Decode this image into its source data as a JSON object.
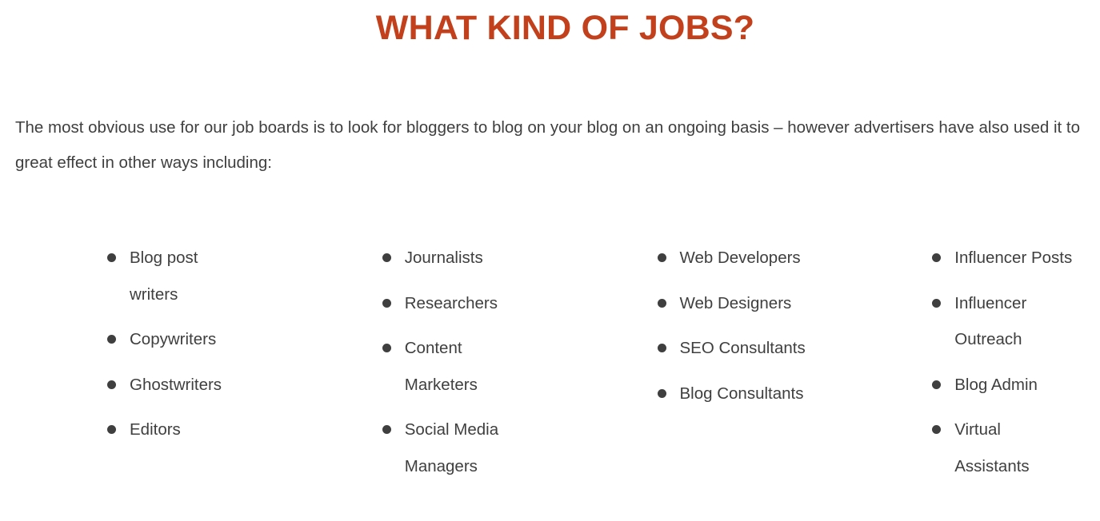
{
  "page": {
    "background_color": "#ffffff",
    "text_color": "#3f3f3f",
    "accent_color": "#c2401b",
    "bullet_color": "#3f3f3f"
  },
  "heading": {
    "text": "WHAT KIND OF JOBS?"
  },
  "intro": {
    "paragraph": "The most obvious use for our job boards is to look for bloggers to blog on your blog on an ongoing basis – however advertisers have also used it to great effect in other ways including:"
  },
  "columns": [
    {
      "id": "column-1",
      "items": [
        {
          "label": "Blog post writers"
        },
        {
          "label": "Copywriters"
        },
        {
          "label": "Ghostwriters"
        },
        {
          "label": "Editors"
        }
      ]
    },
    {
      "id": "column-2",
      "items": [
        {
          "label": "Journalists"
        },
        {
          "label": "Researchers"
        },
        {
          "label": "Content Marketers"
        },
        {
          "label": "Social Media Managers"
        }
      ]
    },
    {
      "id": "column-3",
      "items": [
        {
          "label": "Web Developers"
        },
        {
          "label": "Web Designers"
        },
        {
          "label": "SEO Consultants"
        },
        {
          "label": "Blog Consultants"
        }
      ]
    },
    {
      "id": "column-4",
      "items": [
        {
          "label": "Influencer Posts"
        },
        {
          "label": "Influencer Outreach"
        },
        {
          "label": "Blog Admin"
        },
        {
          "label": "Virtual Assistants"
        }
      ]
    }
  ]
}
